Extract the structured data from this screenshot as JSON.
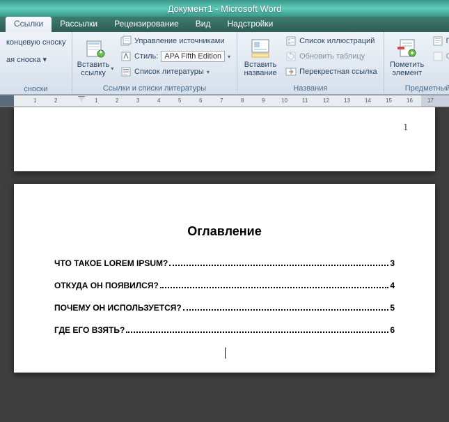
{
  "title": "Документ1 - Microsoft Word",
  "tabs": [
    "Ссылки",
    "Рассылки",
    "Рецензирование",
    "Вид",
    "Надстройки"
  ],
  "ribbon": {
    "g1": {
      "r1": "концевую сноску",
      "r2": "ая сноска ▾",
      "label": "сноски"
    },
    "g2": {
      "big": "Вставить\nссылку",
      "r1": "Управление источниками",
      "r2_label": "Стиль:",
      "r2_value": "APA Fifth Edition",
      "r3": "Список литературы",
      "label": "Ссылки и списки литературы"
    },
    "g3": {
      "big": "Вставить\nназвание",
      "r1": "Список иллюстраций",
      "r2": "Обновить таблицу",
      "r3": "Перекрестная ссылка",
      "label": "Названия"
    },
    "g4": {
      "big": "Пометить\nэлемент",
      "r1": "Пред",
      "r2": "Обно",
      "label": "Предметный"
    }
  },
  "ruler_nums": [
    "1",
    "2",
    "1",
    "2",
    "3",
    "4",
    "5",
    "6",
    "7",
    "8",
    "9",
    "10",
    "11",
    "12",
    "13",
    "14",
    "15",
    "16",
    "17"
  ],
  "page1_num": "1",
  "toc": {
    "title": "Оглавление",
    "rows": [
      {
        "t": "ЧТО ТАКОЕ LOREM IPSUM?",
        "p": "3"
      },
      {
        "t": "ОТКУДА ОН ПОЯВИЛСЯ?",
        "p": "4"
      },
      {
        "t": "ПОЧЕМУ ОН ИСПОЛЬЗУЕТСЯ?",
        "p": "5"
      },
      {
        "t": "ГДЕ ЕГО ВЗЯТЬ?",
        "p": "6"
      }
    ]
  }
}
